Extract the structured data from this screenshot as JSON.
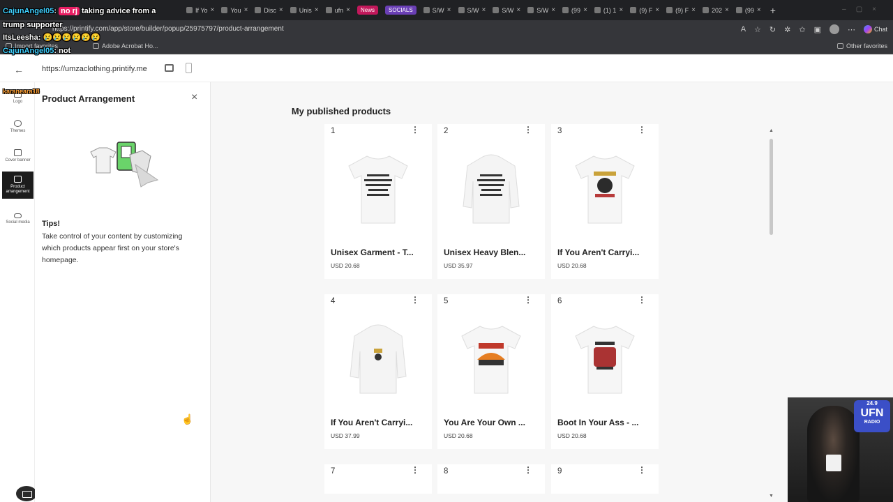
{
  "browser": {
    "tabs": [
      "If Yo",
      "You",
      "Disc",
      "Unis",
      "ufn",
      "S/W",
      "S/W",
      "S/W",
      "S/W",
      "(99",
      "(1) 1",
      "(9) F",
      "(9) F",
      "202",
      "(99"
    ],
    "pills": {
      "news": "News",
      "socials": "SOCIALS"
    },
    "url": "https://printify.com/app/store/builder/popup/25975797/product-arrangement",
    "chat_label": "Chat",
    "bookmarks": {
      "import": "Import favorites",
      "acrobat": "Adobe Acrobat Ho...",
      "other": "Other favorites"
    }
  },
  "stream_chat": [
    {
      "name": "CajunAngel05",
      "message": "no rj taking advice from a"
    },
    {
      "name": "",
      "message": "trump supporter"
    },
    {
      "name": "ItsLeesha",
      "message": "😢😢😢😢😢😢"
    },
    {
      "name": "CajunAngel05",
      "message": "not"
    },
    {
      "name": "karaneara18",
      "message": ""
    }
  ],
  "builder": {
    "store_url": "https://umzaclothing.printify.me",
    "rail": [
      {
        "label": "Logo"
      },
      {
        "label": "Themes"
      },
      {
        "label": "Cover banner"
      },
      {
        "label": "Product arrangement"
      },
      {
        "label": "Social media"
      }
    ],
    "panel": {
      "title": "Product Arrangement",
      "tips_title": "Tips!",
      "tips_text": "Take control of your content by customizing which products appear first on your store's homepage."
    },
    "canvas_title": "My published products",
    "products": [
      {
        "num": "1",
        "name": "Unisex Garment - T...",
        "price": "USD 20.68"
      },
      {
        "num": "2",
        "name": "Unisex Heavy Blen...",
        "price": "USD 35.97"
      },
      {
        "num": "3",
        "name": "If You Aren't Carryi...",
        "price": "USD 20.68"
      },
      {
        "num": "4",
        "name": "If You Aren't Carryi...",
        "price": "USD 37.99"
      },
      {
        "num": "5",
        "name": "You Are Your Own ...",
        "price": "USD 20.68"
      },
      {
        "num": "6",
        "name": "Boot In Your Ass - ...",
        "price": "USD 20.68"
      },
      {
        "num": "7",
        "name": "",
        "price": ""
      },
      {
        "num": "8",
        "name": "",
        "price": ""
      },
      {
        "num": "9",
        "name": "",
        "price": ""
      }
    ]
  },
  "webcam_logo": {
    "freq": "24.9",
    "ufn": "UFN",
    "radio": "RADIO"
  }
}
